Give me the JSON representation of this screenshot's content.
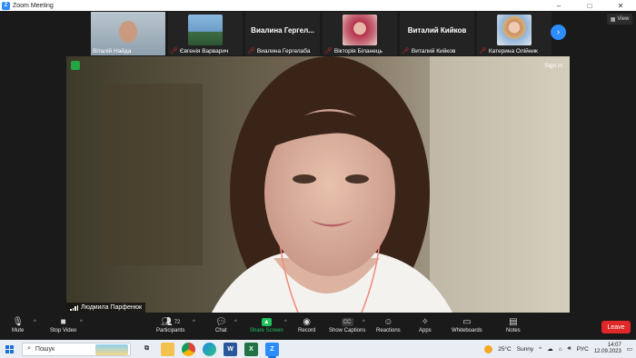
{
  "window": {
    "title": "Zoom Meeting",
    "min": "–",
    "max": "□",
    "close": "✕"
  },
  "view_button": "View",
  "participants_strip": [
    {
      "name": "Віталій Найда",
      "type": "video",
      "muted": false
    },
    {
      "name": "Євгенія Варварич",
      "type": "photo",
      "muted": true
    },
    {
      "name": "Виалина Гергелаба",
      "display": "Виалина  Гергел...",
      "type": "name",
      "muted": true
    },
    {
      "name": "Вікторія Біланець",
      "type": "photo",
      "muted": true
    },
    {
      "name": "Виталий Кийков",
      "display": "Виталий Кийков",
      "type": "name",
      "muted": true
    },
    {
      "name": "Катерина Олійник",
      "type": "photo",
      "muted": true
    }
  ],
  "main_speaker": {
    "name": "Людмила Парфенюк",
    "signin": "Sign in"
  },
  "toolbar": {
    "mute": "Mute",
    "stop_video": "Stop Video",
    "participants": "Participants",
    "participants_count": "72",
    "chat": "Chat",
    "share_screen": "Share Screen",
    "record": "Record",
    "show_captions": "Show Captions",
    "reactions": "Reactions",
    "apps": "Apps",
    "whiteboards": "Whiteboards",
    "notes": "Notes",
    "leave": "Leave"
  },
  "taskbar": {
    "search_placeholder": "Пошук",
    "weather_temp": "25°C",
    "weather_text": "Sunny",
    "language": "РУС",
    "time": "14:07",
    "date": "12.09.2023"
  },
  "colors": {
    "accent": "#2d8cff",
    "leave": "#e02828",
    "share": "#21c25e"
  }
}
